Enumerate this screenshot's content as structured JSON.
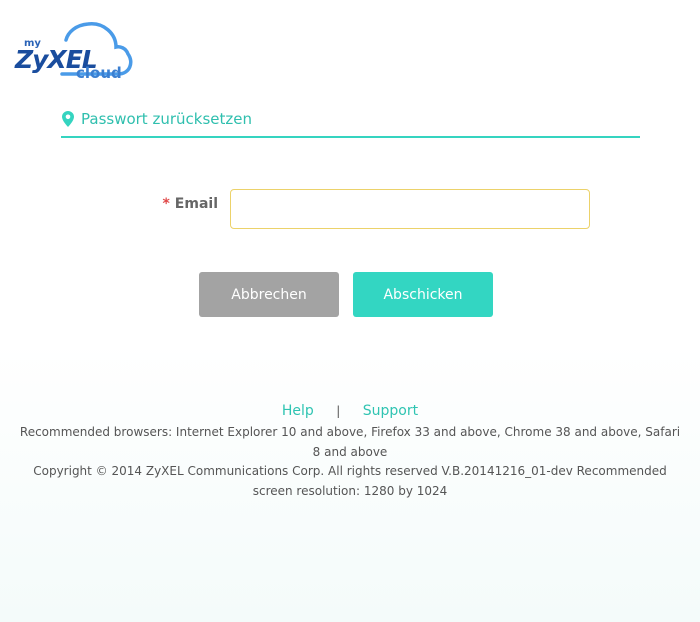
{
  "logo": {
    "my": "my",
    "brand": "ZyXEL",
    "cloud": "cloud"
  },
  "section": {
    "title": "Passwort zurücksetzen",
    "icon": "map-pin-icon",
    "accent": "#35d4c0"
  },
  "form": {
    "required_mark": "*",
    "email_label": "Email",
    "email_value": "",
    "email_placeholder": ""
  },
  "buttons": {
    "cancel": "Abbrechen",
    "submit": "Abschicken"
  },
  "footer": {
    "help": "Help",
    "separator": "|",
    "support": "Support",
    "browsers": "Recommended browsers: Internet Explorer 10 and above, Firefox 33 and above, Chrome 38 and above, Safari 8 and above",
    "copyright": "Copyright © 2014 ZyXEL Communications Corp. All rights reserved V.B.20141216_01-dev Recommended screen resolution: 1280 by 1024"
  }
}
